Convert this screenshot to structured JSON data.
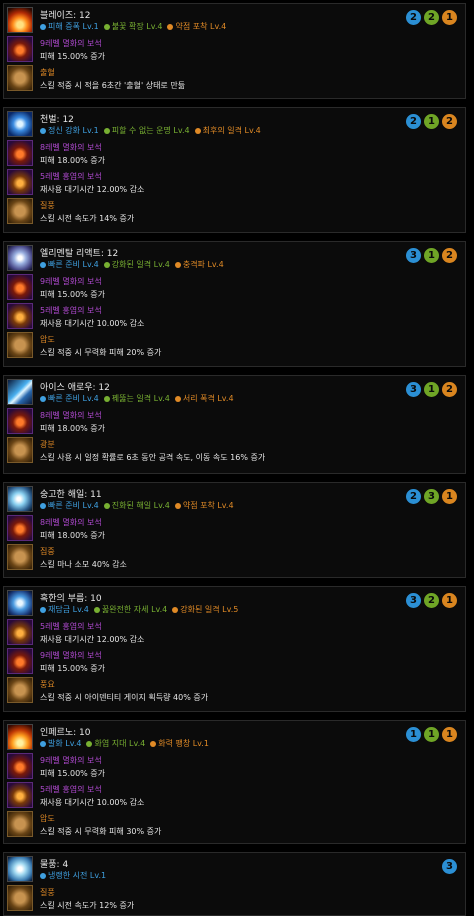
{
  "skills": [
    {
      "name": "블레이즈: 12",
      "icon": "fire-burst-icon",
      "tripods": [
        {
          "color": "blue",
          "text": "피해 증폭 Lv.1"
        },
        {
          "color": "green",
          "text": "불꽃 확장 Lv.4"
        },
        {
          "color": "orange",
          "text": "약점 포착 Lv.4"
        }
      ],
      "levels": [
        {
          "color": "blue",
          "value": "2"
        },
        {
          "color": "green",
          "value": "2"
        },
        {
          "color": "orange",
          "value": "1"
        }
      ],
      "rows": [
        {
          "type": "gem-red",
          "title": "9레벨 멸화의 보석",
          "desc": "피해 15.00% 증가"
        },
        {
          "type": "rune",
          "title": "출혈",
          "desc": "스킬 적중 시 적을 6초간 '출혈' 상태로 만듦"
        }
      ]
    },
    {
      "name": "천벌: 12",
      "icon": "holy-strike-icon",
      "tripods": [
        {
          "color": "blue",
          "text": "정신 강화 Lv.1"
        },
        {
          "color": "green",
          "text": "피할 수 없는 운명 Lv.4"
        },
        {
          "color": "orange",
          "text": "최후의 일격 Lv.4"
        }
      ],
      "levels": [
        {
          "color": "blue",
          "value": "2"
        },
        {
          "color": "green",
          "value": "1"
        },
        {
          "color": "orange",
          "value": "2"
        }
      ],
      "rows": [
        {
          "type": "gem-red",
          "title": "8레벨 멸화의 보석",
          "desc": "피해 18.00% 증가"
        },
        {
          "type": "gem-blue",
          "title": "5레벨 홍염의 보석",
          "desc": "재사용 대기시간 12.00% 감소"
        },
        {
          "type": "rune",
          "title": "질풍",
          "desc": "스킬 시전 속도가 14% 증가"
        }
      ]
    },
    {
      "name": "엘리멘탈 리액트: 12",
      "icon": "elemental-shard-icon",
      "tripods": [
        {
          "color": "blue",
          "text": "빠른 준비 Lv.4"
        },
        {
          "color": "green",
          "text": "강화된 일격 Lv.4"
        },
        {
          "color": "orange",
          "text": "충격파 Lv.4"
        }
      ],
      "levels": [
        {
          "color": "blue",
          "value": "3"
        },
        {
          "color": "green",
          "value": "1"
        },
        {
          "color": "orange",
          "value": "2"
        }
      ],
      "rows": [
        {
          "type": "gem-red",
          "title": "9레벨 멸화의 보석",
          "desc": "피해 15.00% 증가"
        },
        {
          "type": "gem-blue",
          "title": "5레벨 홍염의 보석",
          "desc": "재사용 대기시간 10.00% 감소"
        },
        {
          "type": "rune",
          "title": "압도",
          "desc": "스킬 적중 시 무력화 피해 20% 증가"
        }
      ]
    },
    {
      "name": "아이스 애로우: 12",
      "icon": "ice-arrow-icon",
      "tripods": [
        {
          "color": "blue",
          "text": "빠른 준비 Lv.4"
        },
        {
          "color": "green",
          "text": "꿰뚫는 일격 Lv.4"
        },
        {
          "color": "orange",
          "text": "서리 폭격 Lv.4"
        }
      ],
      "levels": [
        {
          "color": "blue",
          "value": "3"
        },
        {
          "color": "green",
          "value": "1"
        },
        {
          "color": "orange",
          "value": "2"
        }
      ],
      "rows": [
        {
          "type": "gem-red",
          "title": "8레벨 멸화의 보석",
          "desc": "피해 18.00% 증가"
        },
        {
          "type": "rune",
          "title": "광분",
          "desc": "스킬 사용 시 일정 확률로 6초 동안 공격 속도, 이동 속도 16% 증가"
        }
      ]
    },
    {
      "name": "숭고한 해일: 11",
      "icon": "sublime-wave-icon",
      "tripods": [
        {
          "color": "blue",
          "text": "빠른 준비 Lv.4"
        },
        {
          "color": "green",
          "text": "진화된 해일 Lv.4"
        },
        {
          "color": "orange",
          "text": "약점 포착 Lv.4"
        }
      ],
      "levels": [
        {
          "color": "blue",
          "value": "2"
        },
        {
          "color": "green",
          "value": "3"
        },
        {
          "color": "orange",
          "value": "1"
        }
      ],
      "rows": [
        {
          "type": "gem-red",
          "title": "8레벨 멸화의 보석",
          "desc": "피해 18.00% 증가"
        },
        {
          "type": "rune",
          "title": "집중",
          "desc": "스킬 마나 소모 40% 감소"
        }
      ]
    },
    {
      "name": "혹한의 부름: 10",
      "icon": "frost-call-icon",
      "tripods": [
        {
          "color": "blue",
          "text": "재담금 Lv.4"
        },
        {
          "color": "green",
          "text": "꿇완전한 자세 Lv.4"
        },
        {
          "color": "orange",
          "text": "강화된 일격 Lv.5"
        }
      ],
      "levels": [
        {
          "color": "blue",
          "value": "3"
        },
        {
          "color": "green",
          "value": "2"
        },
        {
          "color": "orange",
          "value": "1"
        }
      ],
      "rows": [
        {
          "type": "gem-blue",
          "title": "5레벨 홍염의 보석",
          "desc": "재사용 대기시간 12.00% 감소"
        },
        {
          "type": "gem-red",
          "title": "9레벨 멸화의 보석",
          "desc": "피해 15.00% 증가"
        },
        {
          "type": "rune",
          "title": "풍요",
          "desc": "스킬 적중 시 아이덴티티 게이지 획득량 40% 증가"
        }
      ]
    },
    {
      "name": "인페르노: 10",
      "icon": "inferno-icon",
      "tripods": [
        {
          "color": "blue",
          "text": "발화 Lv.4"
        },
        {
          "color": "green",
          "text": "화염 지대 Lv.4"
        },
        {
          "color": "orange",
          "text": "화력 팽창 Lv.1"
        }
      ],
      "levels": [
        {
          "color": "blue",
          "value": "1"
        },
        {
          "color": "green",
          "value": "1"
        },
        {
          "color": "orange",
          "value": "1"
        }
      ],
      "rows": [
        {
          "type": "gem-red",
          "title": "9레벨 멸화의 보석",
          "desc": "피해 15.00% 증가"
        },
        {
          "type": "gem-blue",
          "title": "5레벨 홍염의 보석",
          "desc": "재사용 대기시간 10.00% 감소"
        },
        {
          "type": "rune",
          "title": "압도",
          "desc": "스킬 적중 시 무력화 피해 30% 증가"
        }
      ]
    },
    {
      "name": "물풍: 4",
      "icon": "frost-wind-icon",
      "tripods": [
        {
          "color": "blue",
          "text": "냉랭한 시전 Lv.1"
        }
      ],
      "levels": [
        {
          "color": "blue",
          "value": "3"
        }
      ],
      "rows": [
        {
          "type": "rune",
          "title": "질풍",
          "desc": "스킬 시전 속도가 12% 증가"
        }
      ]
    }
  ]
}
